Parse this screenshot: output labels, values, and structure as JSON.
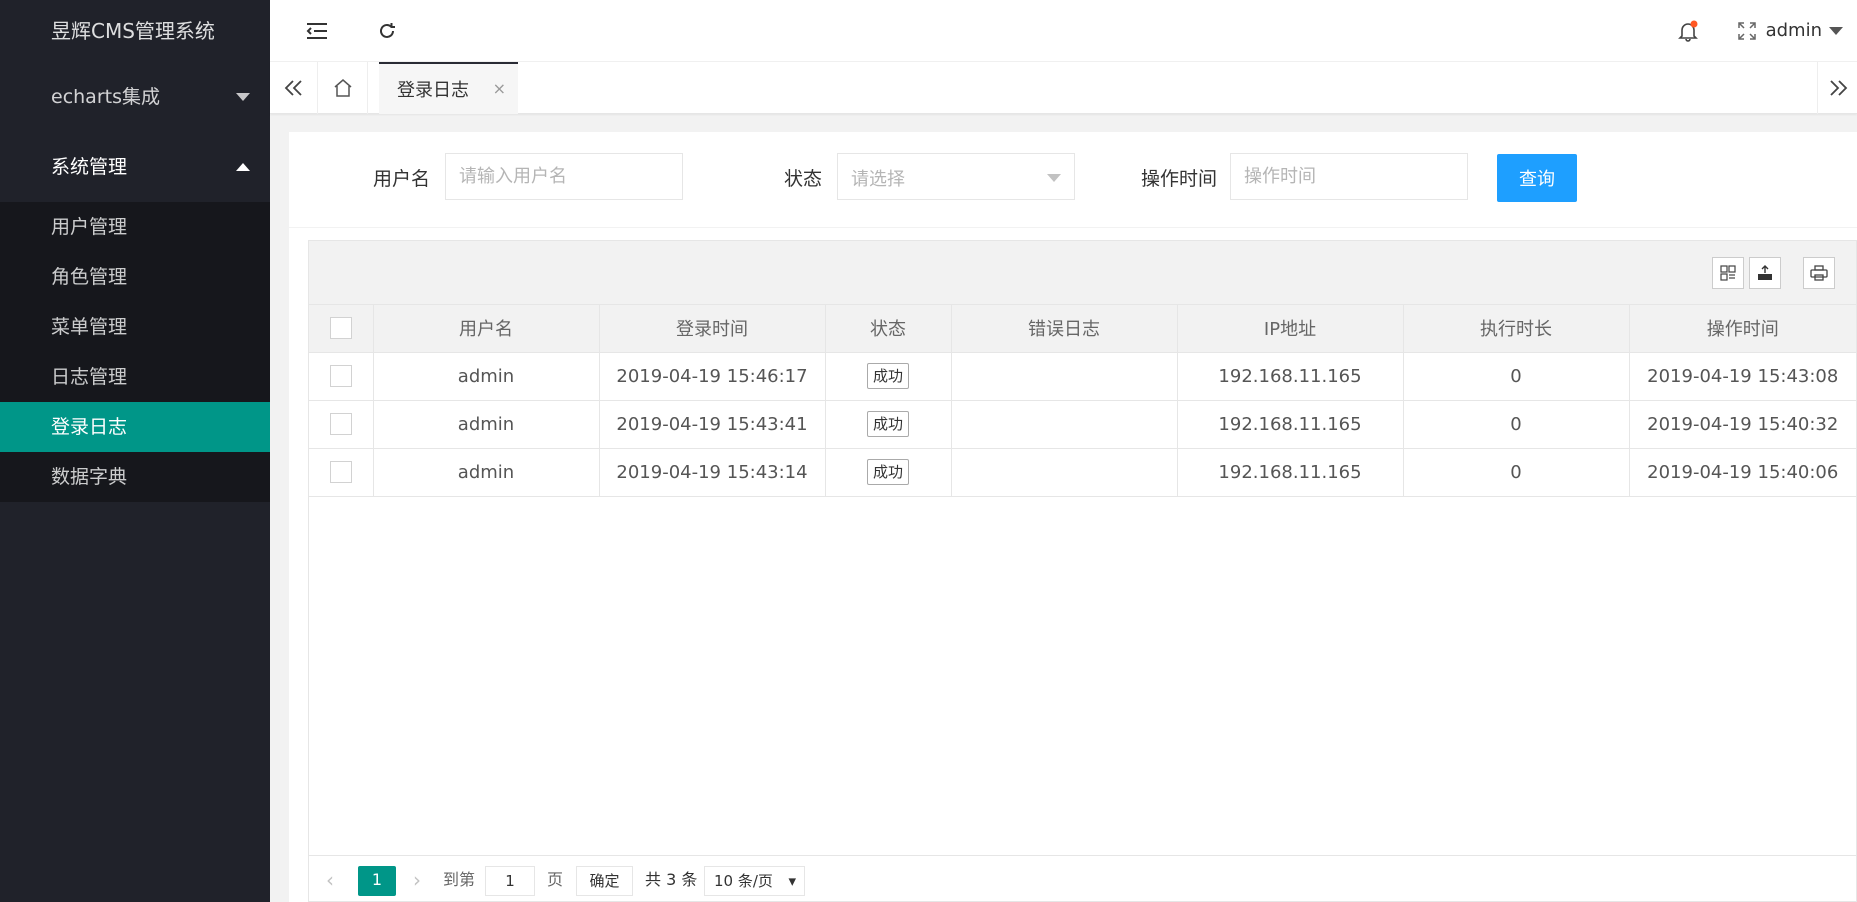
{
  "app": {
    "title": "昱辉CMS管理系统"
  },
  "sidebar": {
    "groups": [
      {
        "label": "echarts集成"
      },
      {
        "label": "系统管理"
      }
    ],
    "items": [
      {
        "label": "用户管理"
      },
      {
        "label": "角色管理"
      },
      {
        "label": "菜单管理"
      },
      {
        "label": "日志管理"
      },
      {
        "label": "登录日志"
      },
      {
        "label": "数据字典"
      }
    ],
    "active_item": "登录日志"
  },
  "header": {
    "user": "admin",
    "icons": [
      "menu-fold-icon",
      "refresh-icon",
      "bell-icon",
      "fullscreen-icon"
    ],
    "notification_dot_color": "#ff5722"
  },
  "tabs": {
    "active_label": "登录日志",
    "close": "×"
  },
  "search": {
    "username_label": "用户名",
    "username_placeholder": "请输入用户名",
    "status_label": "状态",
    "status_placeholder": "请选择",
    "time_label": "操作时间",
    "time_placeholder": "操作时间",
    "query_button": "查询"
  },
  "table": {
    "toolbar_icons": [
      "columns-icon",
      "export-icon",
      "print-icon"
    ],
    "columns": [
      "用户名",
      "登录时间",
      "状态",
      "错误日志",
      "IP地址",
      "执行时长",
      "操作时间"
    ],
    "rows": [
      {
        "username": "admin",
        "login_time": "2019-04-19 15:46:17",
        "status": "成功",
        "error_log": "",
        "ip": "192.168.11.165",
        "duration": "0",
        "op_time": "2019-04-19 15:43:08"
      },
      {
        "username": "admin",
        "login_time": "2019-04-19 15:43:41",
        "status": "成功",
        "error_log": "",
        "ip": "192.168.11.165",
        "duration": "0",
        "op_time": "2019-04-19 15:40:32"
      },
      {
        "username": "admin",
        "login_time": "2019-04-19 15:43:14",
        "status": "成功",
        "error_log": "",
        "ip": "192.168.11.165",
        "duration": "0",
        "op_time": "2019-04-19 15:40:06"
      }
    ]
  },
  "pager": {
    "current_page": "1",
    "goto_label": "到第",
    "goto_value": "1",
    "page_unit": "页",
    "confirm": "确定",
    "total": "共 3 条",
    "page_size": "10 条/页"
  },
  "colors": {
    "sidebar_bg": "#20222a",
    "accent": "#009688",
    "primary_button": "#1e9fff"
  }
}
